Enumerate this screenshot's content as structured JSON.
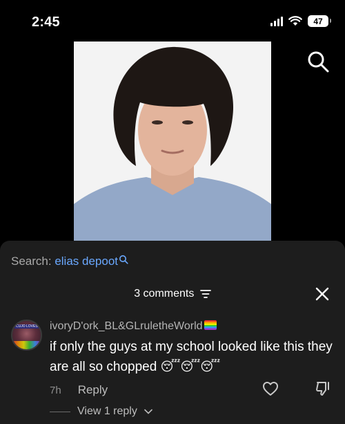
{
  "status": {
    "time": "2:45",
    "battery": "47"
  },
  "search": {
    "prefix": "Search:",
    "query": "elias depoot"
  },
  "comments": {
    "count_label": "3 comments"
  },
  "comment": {
    "username": "ivoryD'ork_BL&GLruletheWorld",
    "avatar_badge": "CUJO LOVES",
    "text": "if only the guys at my school looked like this they are all so chopped",
    "emojis": [
      "😴",
      "😴",
      "😴"
    ],
    "age": "7h",
    "reply_label": "Reply",
    "view_replies_label": "View 1 reply"
  },
  "colors": {
    "link": "#6aa8ff",
    "sheet": "#1d1d1d"
  },
  "icons": [
    "signal-icon",
    "wifi-icon",
    "battery-icon",
    "search-icon",
    "filter-icon",
    "close-icon",
    "heart-icon",
    "dislike-icon",
    "chevron-down-icon"
  ]
}
